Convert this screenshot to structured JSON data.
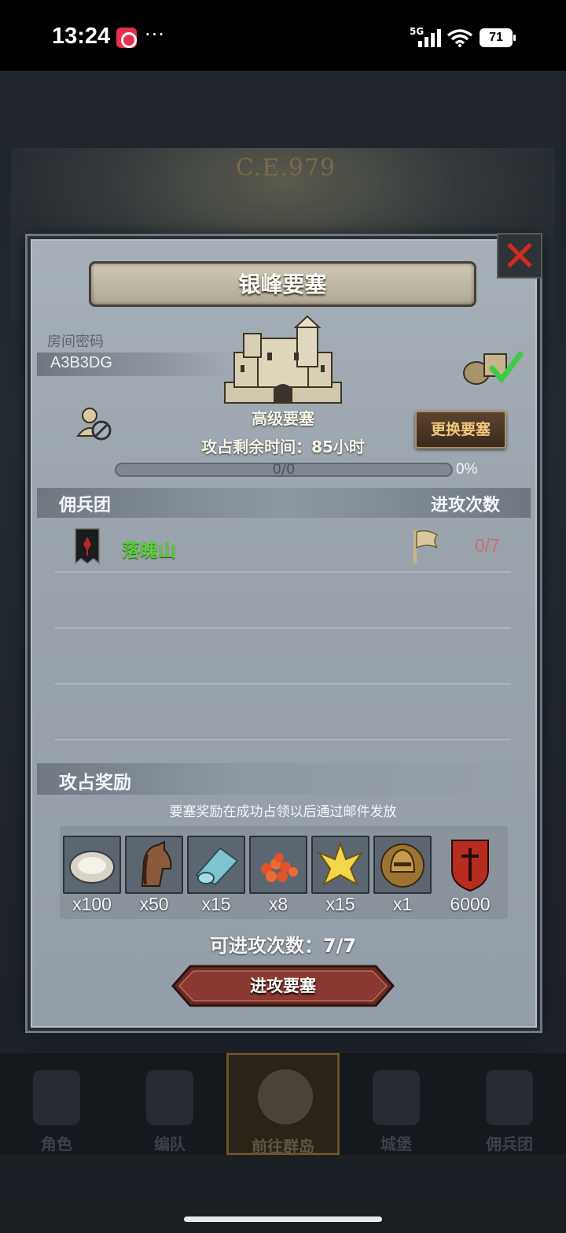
{
  "status_bar": {
    "time": "13:24",
    "dots": "···",
    "network": "5G",
    "battery": "71"
  },
  "background": {
    "era_label": "C.E.979"
  },
  "modal": {
    "title": "银峰要塞",
    "room_label": "房间密码",
    "room_code": "A3B3DG",
    "fortress_type": "高级要塞",
    "swap_button": "更换要塞",
    "time_left": "攻占剩余时间：85小时",
    "progress_text": "0/0",
    "progress_percent": "0%",
    "progress_fraction": 0,
    "table": {
      "col_left": "佣兵团",
      "col_right": "进攻次数",
      "rows": [
        {
          "name": "落魄山",
          "attacks": "0/7"
        }
      ]
    },
    "rewards": {
      "title": "攻占奖励",
      "note": "要塞奖励在成功占领以后通过邮件发放",
      "items": [
        {
          "icon": "oyster-icon",
          "qty": "x100"
        },
        {
          "icon": "horse-icon",
          "qty": "x50"
        },
        {
          "icon": "cloth-roll-icon",
          "qty": "x15"
        },
        {
          "icon": "fish-roe-icon",
          "qty": "x8"
        },
        {
          "icon": "gold-crest-icon",
          "qty": "x15"
        },
        {
          "icon": "knight-helmet-icon",
          "qty": "x1"
        },
        {
          "icon": "guild-shield-icon",
          "qty": "6000"
        }
      ]
    },
    "attacks_available": "可进攻次数：7/7",
    "attack_button": "进攻要塞"
  },
  "bottom_nav": {
    "items": [
      {
        "label": "角色"
      },
      {
        "label": "编队"
      },
      {
        "label": "前往群岛"
      },
      {
        "label": "城堡"
      },
      {
        "label": "佣兵团"
      }
    ]
  },
  "colors": {
    "merc_name": "#5bcf3a",
    "attack_count": "#c96f6d",
    "close_x": "#d12a1f",
    "swap_text": "#f2c87a"
  }
}
